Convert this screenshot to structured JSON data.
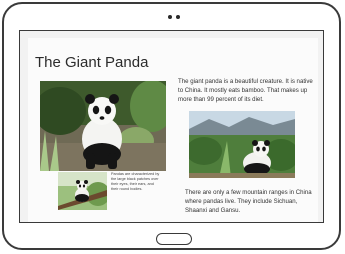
{
  "article": {
    "title": "The Giant Panda",
    "paragraph_1": "The giant panda is a beautiful creature. It is native to China. It mostly eats bamboo. That makes up more than 99 percent of its diet.",
    "paragraph_2": "There are only a few mountain ranges in China where pandas live. They include Sichuan, Shaanxi and Gansu.",
    "caption": "Pandas are characterized by the large black patches over their eyes, their ears, and their round bodies."
  },
  "colors": {
    "frame": "#3a3a3a",
    "foliage": "#4e7a3a",
    "panda_black": "#151515"
  }
}
